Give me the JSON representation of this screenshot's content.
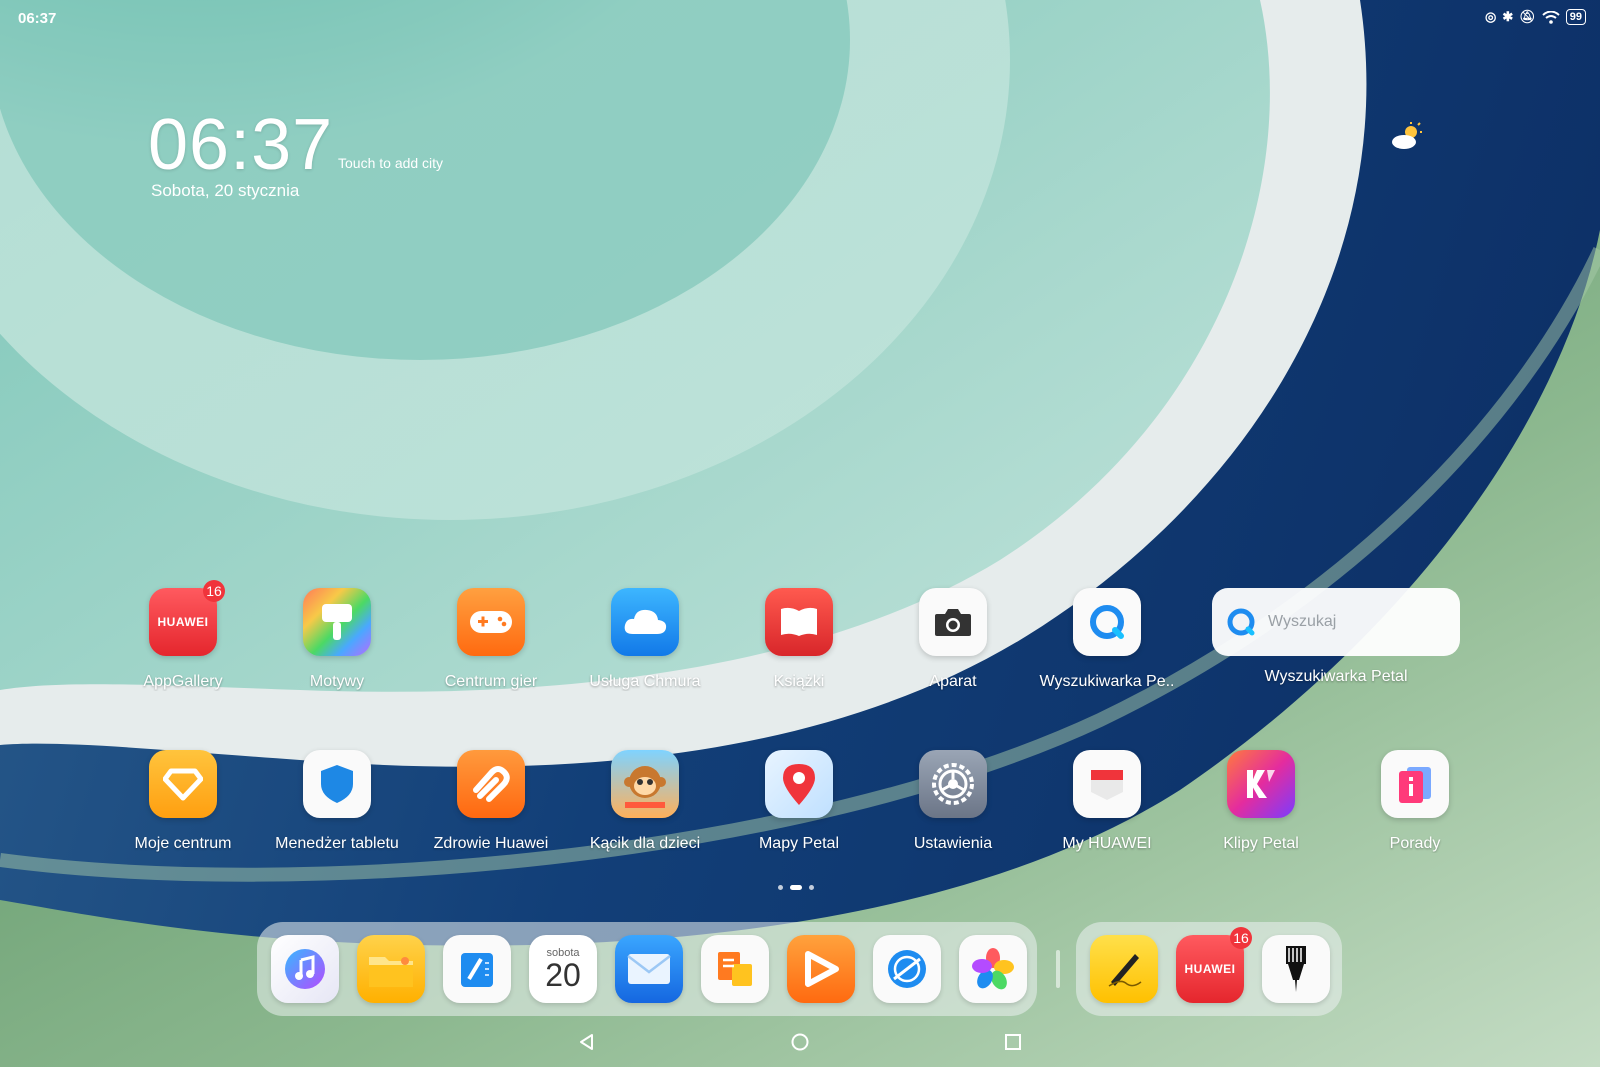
{
  "status_bar": {
    "time": "06:37",
    "battery": "99"
  },
  "clock_widget": {
    "time": "06:37",
    "city_hint": "Touch to add city",
    "date": "Sobota, 20 stycznia"
  },
  "apps_row1": [
    {
      "label": "AppGallery",
      "badge": "16",
      "icon": "appgallery-icon"
    },
    {
      "label": "Motywy",
      "icon": "themes-brush-icon"
    },
    {
      "label": "Centrum gier",
      "icon": "gamepad-icon"
    },
    {
      "label": "Usługa Chmura",
      "icon": "cloud-icon"
    },
    {
      "label": "Książki",
      "icon": "book-icon"
    },
    {
      "label": "Aparat",
      "icon": "camera-icon"
    },
    {
      "label": "Wyszukiwarka Pe..",
      "icon": "petal-search-icon"
    }
  ],
  "search_widget": {
    "placeholder": "Wyszukaj",
    "label": "Wyszukiwarka Petal"
  },
  "apps_row2": [
    {
      "label": "Moje centrum",
      "icon": "diamond-icon"
    },
    {
      "label": "Menedżer tabletu",
      "icon": "shield-icon"
    },
    {
      "label": "Zdrowie Huawei",
      "icon": "health-icon"
    },
    {
      "label": "Kącik dla dzieci",
      "icon": "monkey-icon"
    },
    {
      "label": "Mapy Petal",
      "icon": "map-pin-icon"
    },
    {
      "label": "Ustawienia",
      "icon": "gear-icon"
    },
    {
      "label": "My HUAWEI",
      "icon": "my-huawei-icon"
    },
    {
      "label": "Klipy Petal",
      "icon": "petal-clips-icon"
    },
    {
      "label": "Porady",
      "icon": "tips-icon"
    }
  ],
  "huawei_text": "HUAWEI",
  "dock": {
    "calendar_day": "sobota",
    "calendar_date": "20",
    "badge": "16",
    "apps": [
      "music-icon",
      "files-icon",
      "notepad-icon",
      "calendar-icon",
      "email-icon",
      "docs-icon",
      "video-icon",
      "browser-icon",
      "gallery-icon",
      "sign-pen-icon",
      "appgallery-icon",
      "ink-pen-icon"
    ]
  },
  "colors": {
    "badge": "#f0343b",
    "accent_blue": "#1e8cf0"
  }
}
